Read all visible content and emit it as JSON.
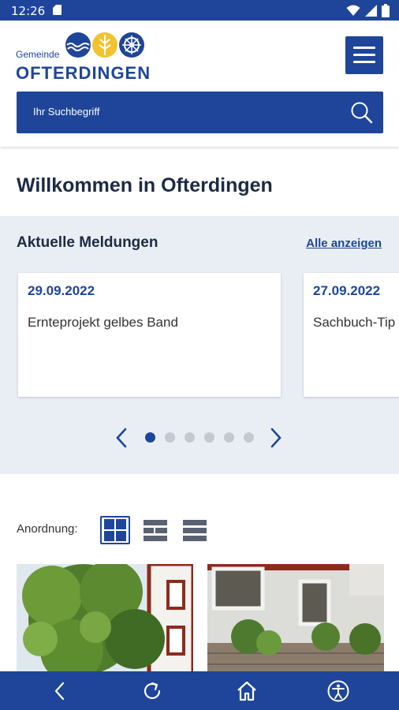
{
  "status_bar": {
    "time": "12:26"
  },
  "header": {
    "logo_small": "Gemeinde",
    "logo_name": "OFTERDINGEN",
    "search_placeholder": "Ihr Suchbegriff"
  },
  "welcome": "Willkommen in Ofterdingen",
  "news": {
    "title": "Aktuelle Meldungen",
    "show_all": "Alle anzeigen",
    "items": [
      {
        "date": "29.09.2022",
        "title": "Ernteprojekt gelbes Band"
      },
      {
        "date": "27.09.2022",
        "title": "Sachbuch-Tip"
      }
    ],
    "pages": 6,
    "active_page": 1
  },
  "layout": {
    "label": "Anordnung:",
    "selected": "grid"
  },
  "colors": {
    "primary": "#1e4599",
    "panel": "#e9eef5",
    "text": "#1c2a44"
  },
  "icons": {
    "menu": "hamburger-icon",
    "search": "search-icon",
    "nav": [
      "back-icon",
      "reload-icon",
      "home-icon",
      "accessibility-icon"
    ]
  }
}
